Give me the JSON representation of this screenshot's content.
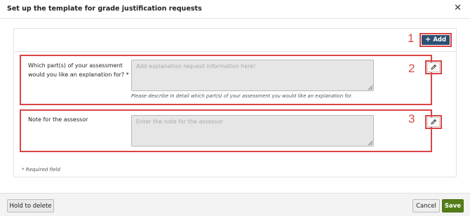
{
  "dialog": {
    "title": "Set up the template for grade justification requests",
    "close_icon": "close-icon"
  },
  "toolbar": {
    "add_label": "Add",
    "add_icon": "plus-icon",
    "callout": "1"
  },
  "fields": [
    {
      "label_line1": "Which part(s) of your assessment",
      "label_line2": "would you like an explanation for? *",
      "placeholder": "Add explanation request information here!",
      "hint": "Please describe in detail which part(s) of your assessment you would like an explanation for.",
      "callout": "2",
      "edit_icon": "pencil-icon"
    },
    {
      "label_line1": "Note for the assessor",
      "placeholder": "Enter the note for the assessor",
      "callout": "3",
      "edit_icon": "pencil-icon"
    }
  ],
  "required_note": "* Required field",
  "footer": {
    "hold_label": "Hold to delete",
    "cancel_label": "Cancel",
    "save_label": "Save"
  },
  "colors": {
    "accent_blue": "#2d4f72",
    "save_green": "#547d18",
    "highlight_red": "#d94545"
  }
}
